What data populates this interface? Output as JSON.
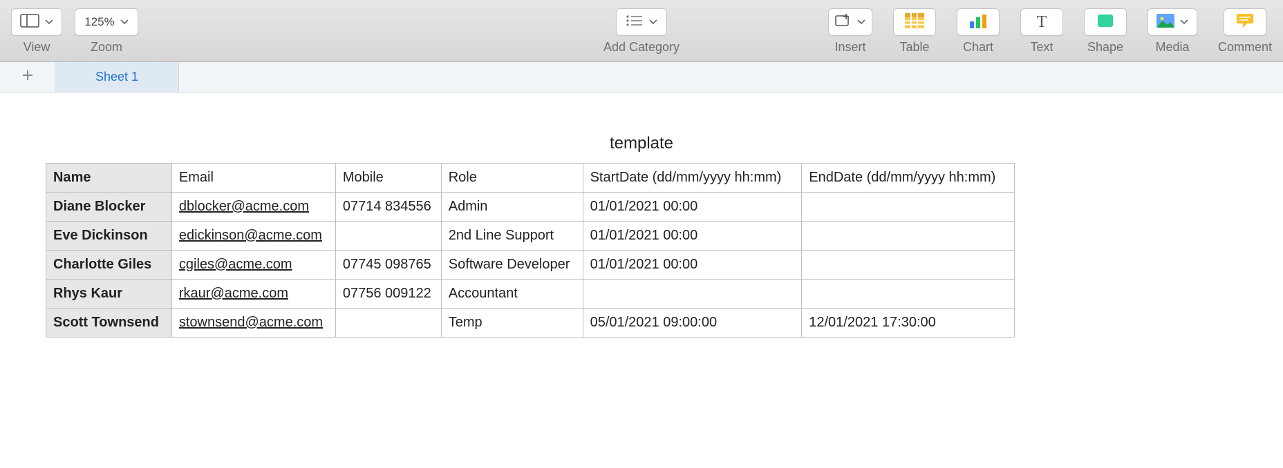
{
  "toolbar": {
    "view": {
      "label": "View"
    },
    "zoom": {
      "value": "125%",
      "label": "Zoom"
    },
    "add_category": {
      "label": "Add Category"
    },
    "insert": {
      "label": "Insert"
    },
    "table": {
      "label": "Table"
    },
    "chart": {
      "label": "Chart"
    },
    "text": {
      "label": "Text"
    },
    "shape": {
      "label": "Shape"
    },
    "media": {
      "label": "Media"
    },
    "comment": {
      "label": "Comment"
    }
  },
  "sheets": {
    "active": "Sheet 1"
  },
  "table": {
    "title": "template",
    "headers": {
      "name": "Name",
      "email": "Email",
      "mobile": "Mobile",
      "role": "Role",
      "start": "StartDate (dd/mm/yyyy hh:mm)",
      "end": "EndDate (dd/mm/yyyy hh:mm)"
    },
    "rows": [
      {
        "name": "Diane Blocker",
        "email": "dblocker@acme.com",
        "mobile": "07714 834556",
        "role": "Admin",
        "start": "01/01/2021 00:00",
        "end": ""
      },
      {
        "name": "Eve Dickinson",
        "email": "edickinson@acme.com",
        "mobile": "",
        "role": "2nd Line Support",
        "start": "01/01/2021 00:00",
        "end": ""
      },
      {
        "name": "Charlotte Giles",
        "email": "cgiles@acme.com",
        "mobile": "07745 098765",
        "role": "Software Developer",
        "start": "01/01/2021 00:00",
        "end": ""
      },
      {
        "name": "Rhys Kaur",
        "email": "rkaur@acme.com",
        "mobile": "07756 009122",
        "role": "Accountant",
        "start": "",
        "end": ""
      },
      {
        "name": "Scott Townsend",
        "email": "stownsend@acme.com",
        "mobile": "",
        "role": "Temp",
        "start": "05/01/2021 09:00:00",
        "end": "12/01/2021 17:30:00"
      }
    ]
  }
}
